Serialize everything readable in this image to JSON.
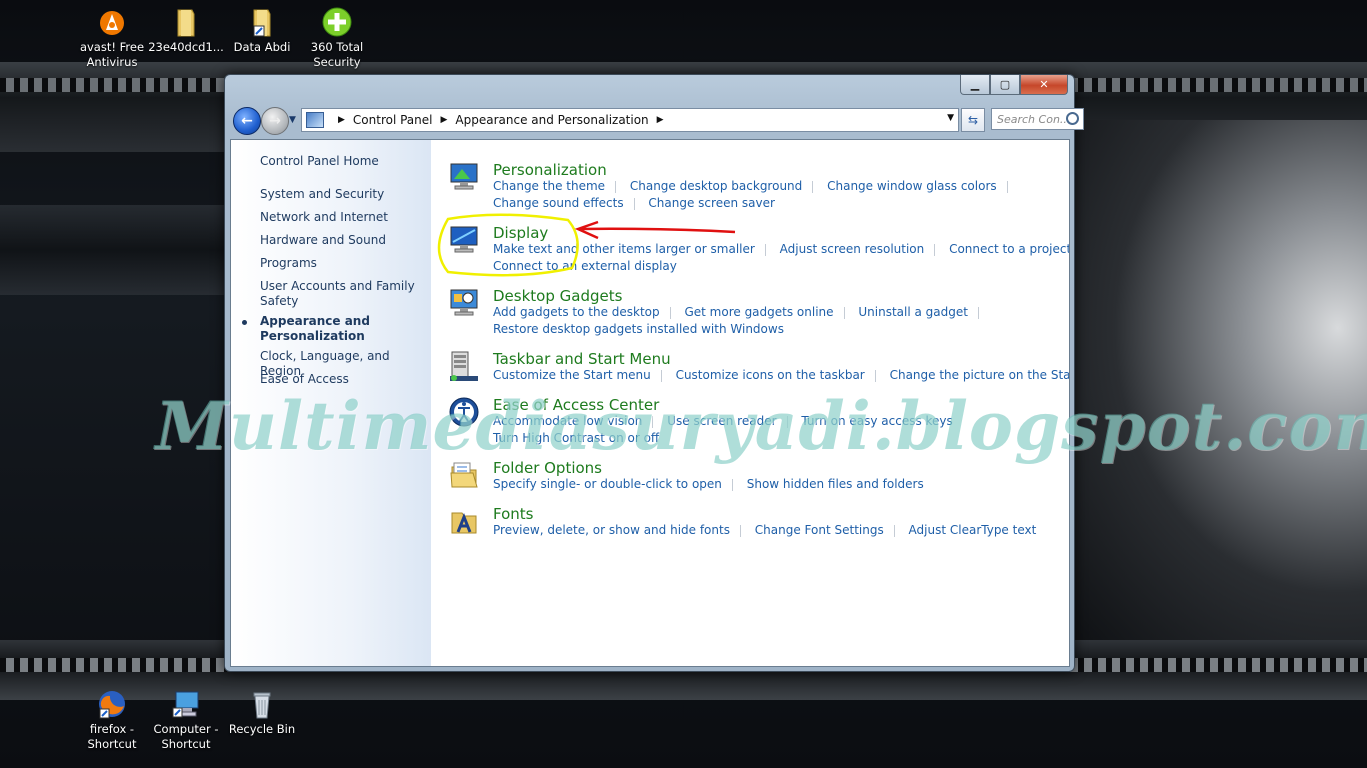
{
  "desktop_icons_top": [
    {
      "label": "avast! Free Antivirus"
    },
    {
      "label": "23e40dcd1..."
    },
    {
      "label": "Data Abdi"
    },
    {
      "label": "360 Total Security"
    }
  ],
  "desktop_icons_bottom": [
    {
      "label": "firefox - Shortcut"
    },
    {
      "label": "Computer - Shortcut"
    },
    {
      "label": "Recycle Bin"
    }
  ],
  "window": {
    "buttons": {
      "minimize": "▁",
      "maximize": "▢",
      "close": "✕"
    },
    "address": {
      "crumbs": [
        "Control Panel",
        "Appearance and Personalization"
      ]
    },
    "search_placeholder": "Search Con..."
  },
  "left_nav": {
    "home": "Control Panel Home",
    "items": [
      "System and Security",
      "Network and Internet",
      "Hardware and Sound",
      "Programs",
      "User Accounts and Family Safety",
      "Appearance and Personalization",
      "Clock, Language, and Region",
      "Ease of Access"
    ],
    "current_index": 5
  },
  "categories": [
    {
      "title": "Personalization",
      "lines": [
        [
          "Change the theme",
          "Change desktop background",
          "Change window glass colors"
        ],
        [
          "Change sound effects",
          "Change screen saver"
        ]
      ]
    },
    {
      "title": "Display",
      "lines": [
        [
          "Make text and other items larger or smaller",
          "Adjust screen resolution",
          "Connect to a projector"
        ],
        [
          "Connect to an external display"
        ]
      ]
    },
    {
      "title": "Desktop Gadgets",
      "lines": [
        [
          "Add gadgets to the desktop",
          "Get more gadgets online",
          "Uninstall a gadget"
        ],
        [
          "Restore desktop gadgets installed with Windows"
        ]
      ]
    },
    {
      "title": "Taskbar and Start Menu",
      "lines": [
        [
          "Customize the Start menu",
          "Customize icons on the taskbar",
          "Change the picture on the Start menu"
        ]
      ]
    },
    {
      "title": "Ease of Access Center",
      "lines": [
        [
          "Accommodate low vision",
          "Use screen reader",
          "Turn on easy access keys"
        ],
        [
          "Turn High Contrast on or off"
        ]
      ]
    },
    {
      "title": "Folder Options",
      "lines": [
        [
          "Specify single- or double-click to open",
          "Show hidden files and folders"
        ]
      ]
    },
    {
      "title": "Fonts",
      "lines": [
        [
          "Preview, delete, or show and hide fonts",
          "Change Font Settings",
          "Adjust ClearType text"
        ]
      ]
    }
  ],
  "watermark": "Multimediasuryadi.blogspot.com",
  "colors": {
    "link": "#1f5fa8",
    "category_title": "#1e7b1e",
    "highlight_ellipse": "#f0f000",
    "arrow": "#e01010"
  }
}
